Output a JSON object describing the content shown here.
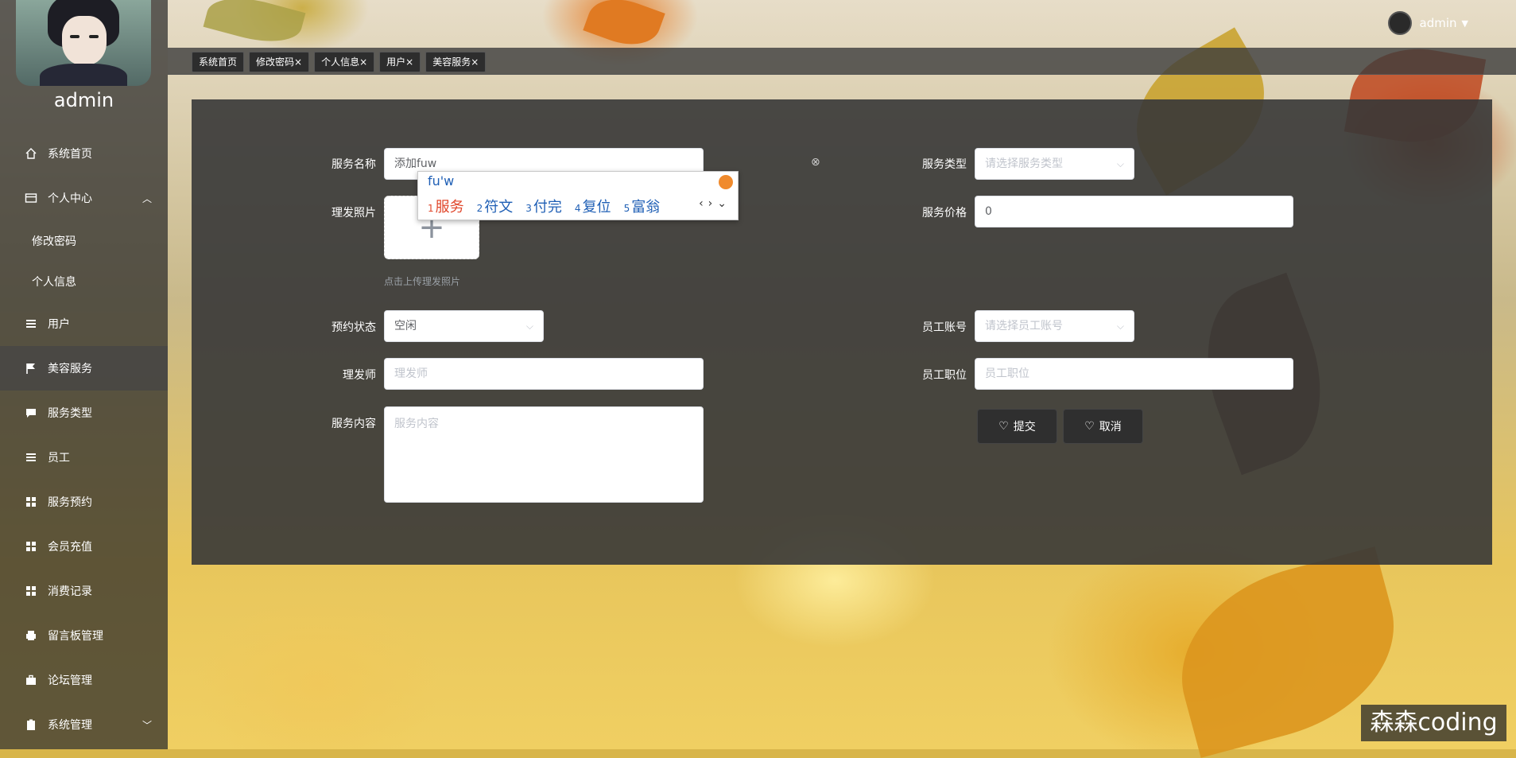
{
  "user": {
    "name": "admin",
    "dropdown_user": "admin"
  },
  "sidebar": {
    "items": [
      {
        "label": "系统首页",
        "icon": "home-icon"
      },
      {
        "label": "个人中心",
        "icon": "card-icon",
        "expanded": true
      },
      {
        "label": "修改密码",
        "sub": true
      },
      {
        "label": "个人信息",
        "sub": true
      },
      {
        "label": "用户",
        "icon": "list-icon"
      },
      {
        "label": "美容服务",
        "icon": "flag-icon",
        "active": true
      },
      {
        "label": "服务类型",
        "icon": "chat-icon"
      },
      {
        "label": "员工",
        "icon": "list-icon"
      },
      {
        "label": "服务预约",
        "icon": "grid-icon"
      },
      {
        "label": "会员充值",
        "icon": "grid-icon"
      },
      {
        "label": "消费记录",
        "icon": "grid-icon"
      },
      {
        "label": "留言板管理",
        "icon": "printer-icon"
      },
      {
        "label": "论坛管理",
        "icon": "briefcase-icon"
      },
      {
        "label": "系统管理",
        "icon": "clipboard-icon"
      }
    ]
  },
  "tags": [
    "系统首页",
    "修改密码×",
    "个人信息×",
    "用户×",
    "美容服务×"
  ],
  "form": {
    "service_name_label": "服务名称",
    "service_name_value": "添加fuw",
    "service_type_label": "服务类型",
    "service_type_placeholder": "请选择服务类型",
    "photo_label": "理发照片",
    "photo_hint": "点击上传理发照片",
    "price_label": "服务价格",
    "price_value": "0",
    "status_label": "预约状态",
    "status_value": "空闲",
    "staff_account_label": "员工账号",
    "staff_account_placeholder": "请选择员工账号",
    "barber_label": "理发师",
    "barber_placeholder": "理发师",
    "staff_position_label": "员工职位",
    "staff_position_placeholder": "员工职位",
    "content_label": "服务内容",
    "content_placeholder": "服务内容",
    "submit_label": "提交",
    "cancel_label": "取消"
  },
  "ime": {
    "code": "fu'w",
    "candidates": [
      {
        "n": "1",
        "text": "服务"
      },
      {
        "n": "2",
        "text": "符文"
      },
      {
        "n": "3",
        "text": "付完"
      },
      {
        "n": "4",
        "text": "复位"
      },
      {
        "n": "5",
        "text": "富翁"
      }
    ]
  },
  "watermark": "森森coding",
  "colors": {
    "sidebar_bg": "#282828",
    "panel_bg": "#373737",
    "ime_highlight": "#e0462a",
    "ime_text": "#1f5fb5"
  }
}
